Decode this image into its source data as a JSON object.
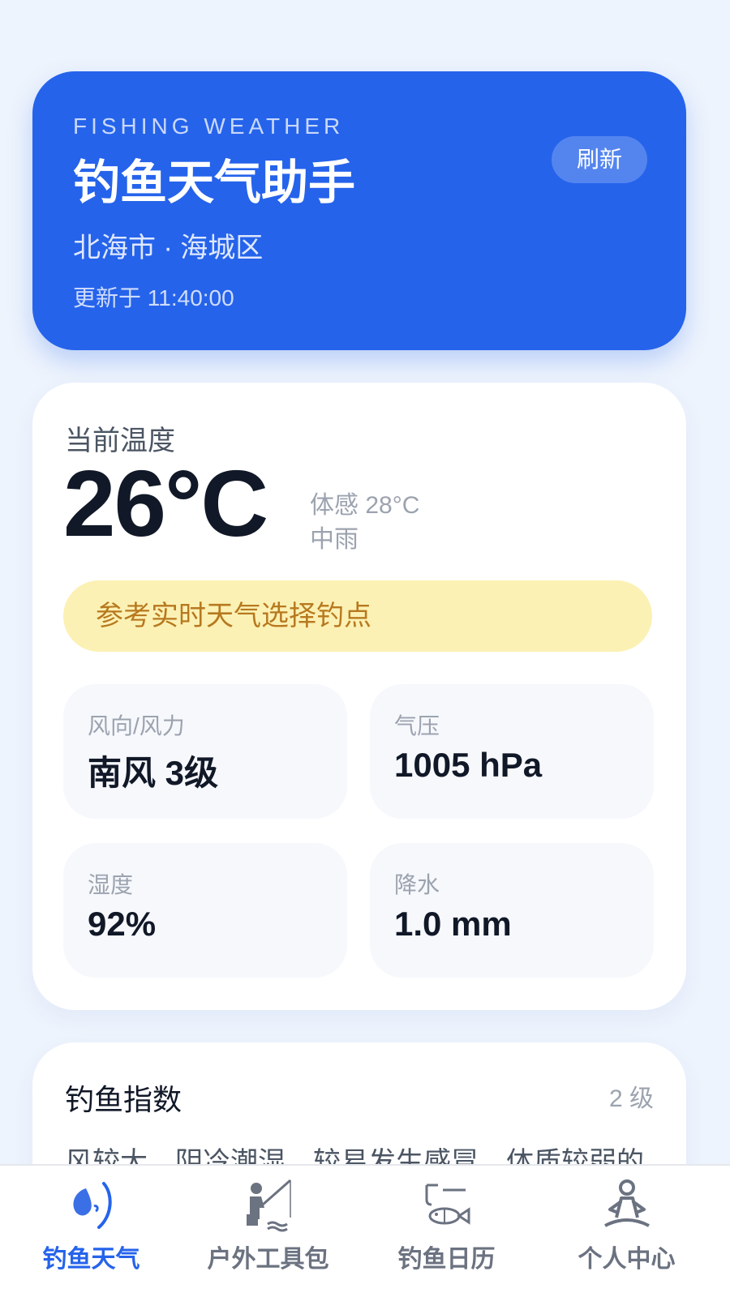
{
  "header": {
    "eyebrow": "FISHING WEATHER",
    "title": "钓鱼天气助手",
    "location": "北海市 · 海城区",
    "updated": "更新于 11:40:00",
    "refresh_label": "刷新",
    "bg_color": "#2563eb"
  },
  "current": {
    "label": "当前温度",
    "temperature": "26°C",
    "feels_like": "体感 28°C",
    "condition": "中雨",
    "tip": "参考实时天气选择钓点",
    "metrics": [
      {
        "label": "风向/风力",
        "value": "南风 3级"
      },
      {
        "label": "气压",
        "value": "1005 hPa"
      },
      {
        "label": "湿度",
        "value": "92%"
      },
      {
        "label": "降水",
        "value": "1.0 mm"
      }
    ]
  },
  "fishing_index": {
    "title": "钓鱼指数",
    "level": "2 级",
    "description": "风较大，阴冷潮湿，较易发生感冒，体质较弱的"
  },
  "tabbar": {
    "active_color": "#2563eb",
    "items": [
      {
        "label": "钓鱼天气",
        "icon": "fishing-weather-icon",
        "active": true
      },
      {
        "label": "户外工具包",
        "icon": "fisherman-icon",
        "active": false
      },
      {
        "label": "钓鱼日历",
        "icon": "fish-calendar-icon",
        "active": false
      },
      {
        "label": "个人中心",
        "icon": "meditation-person-icon",
        "active": false
      }
    ]
  }
}
